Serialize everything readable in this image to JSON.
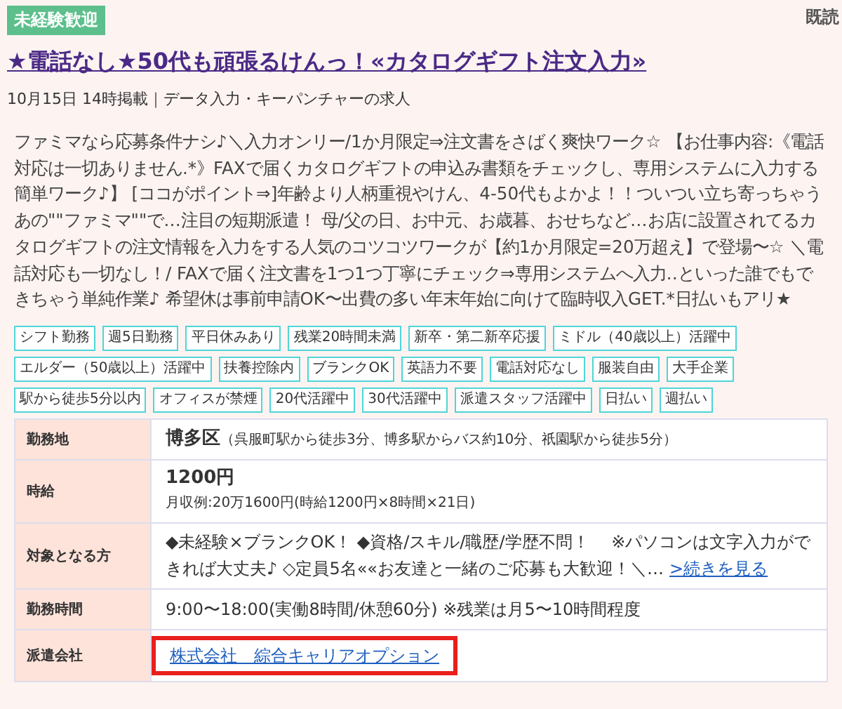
{
  "badge": "未経験歓迎",
  "read_status": "既読",
  "title": "★電話なし★50代も頑張るけんっ！«カタログギフト注文入力»",
  "meta": "10月15日 14時掲載｜データ入力・キーパンチャーの求人",
  "description": "ファミマなら応募条件ナシ♪＼入力オンリー/1か月限定⇒注文書をさばく爽快ワーク☆ 【お仕事内容:《電話対応は一切ありません.*》FAXで届くカタログギフトの申込み書類をチェックし、専用システムに入力する簡単ワーク♪】 [ココがポイント⇒]年齢より人柄重視やけん、4-50代もよかよ！！ついつい立ち寄っちゃうあの\"\"ファミマ\"\"で…注目の短期派遣！ 母/父の日、お中元、お歳暮、おせちなど…お店に設置されてるカタログギフトの注文情報を入力をする人気のコツコツワークが【約1か月限定=20万超え】で登場〜☆ ＼電話対応も一切なし！/ FAXで届く注文書を1つ1つ丁寧にチェック⇒専用システムへ入力‥といった誰でもできちゃう単純作業♪ 希望休は事前申請OK〜出費の多い年末年始に向けて臨時収入GET.*日払いもアリ★",
  "tags": [
    "シフト勤務",
    "週5日勤務",
    "平日休みあり",
    "残業20時間未満",
    "新卒・第二新卒応援",
    "ミドル（40歳以上）活躍中",
    "エルダー（50歳以上）活躍中",
    "扶養控除内",
    "ブランクOK",
    "英語力不要",
    "電話対応なし",
    "服装自由",
    "大手企業",
    "駅から徒歩5分以内",
    "オフィスが禁煙",
    "20代活躍中",
    "30代活躍中",
    "派遣スタッフ活躍中",
    "日払い",
    "週払い"
  ],
  "details": [
    {
      "kind": "main_sub",
      "label": "勤務地",
      "main": "博多区",
      "sub": "（呉服町駅から徒歩3分、博多駅からバス約10分、祇園駅から徒歩5分）"
    },
    {
      "kind": "main_below",
      "label": "時給",
      "main": "1200円",
      "sub": "月収例:20万1600円(時給1200円×8時間×21日)"
    },
    {
      "kind": "text_link",
      "label": "対象となる方",
      "text": "◆未経験×ブランクOK！ ◆資格/スキル/職歴/学歴不問！　 ※パソコンは文字入力ができれば大丈夫♪ ◇定員5名««お友達と一緒のご応募も大歓迎！＼…",
      "link": ">続きを見る"
    },
    {
      "kind": "text",
      "label": "勤務時間",
      "text": "9:00〜18:00(実働8時間/休憩60分) ※残業は月5〜10時間程度"
    },
    {
      "kind": "link",
      "label": "派遣会社",
      "link": "株式会社　綜合キャリアオプション",
      "highlighted": true
    }
  ]
}
